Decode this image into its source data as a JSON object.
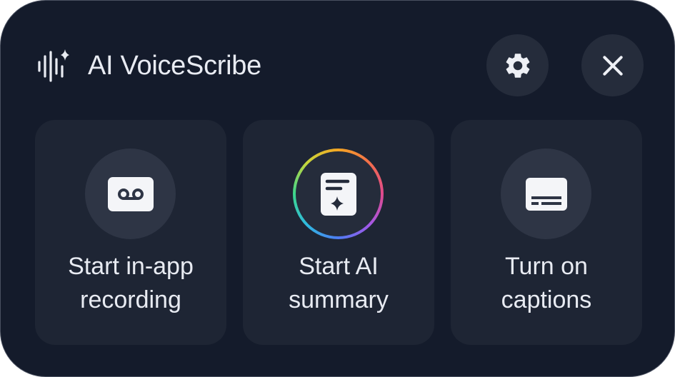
{
  "header": {
    "title": "AI VoiceScribe",
    "logo_icon": "voice-sparkle-icon"
  },
  "buttons": {
    "settings_icon": "gear-icon",
    "close_icon": "close-icon"
  },
  "cards": [
    {
      "label_line1": "Start in-app",
      "label_line2": "recording",
      "icon": "voicemail-icon"
    },
    {
      "label_line1": "Start AI",
      "label_line2": "summary",
      "icon": "sparkle-document-icon"
    },
    {
      "label_line1": "Turn on",
      "label_line2": "captions",
      "icon": "captions-icon"
    }
  ],
  "colors": {
    "background": "#141b2b",
    "card": "#1e2534",
    "icon_circle": "#2e3545",
    "button": "#252c3b",
    "text": "#e8ebf2"
  }
}
